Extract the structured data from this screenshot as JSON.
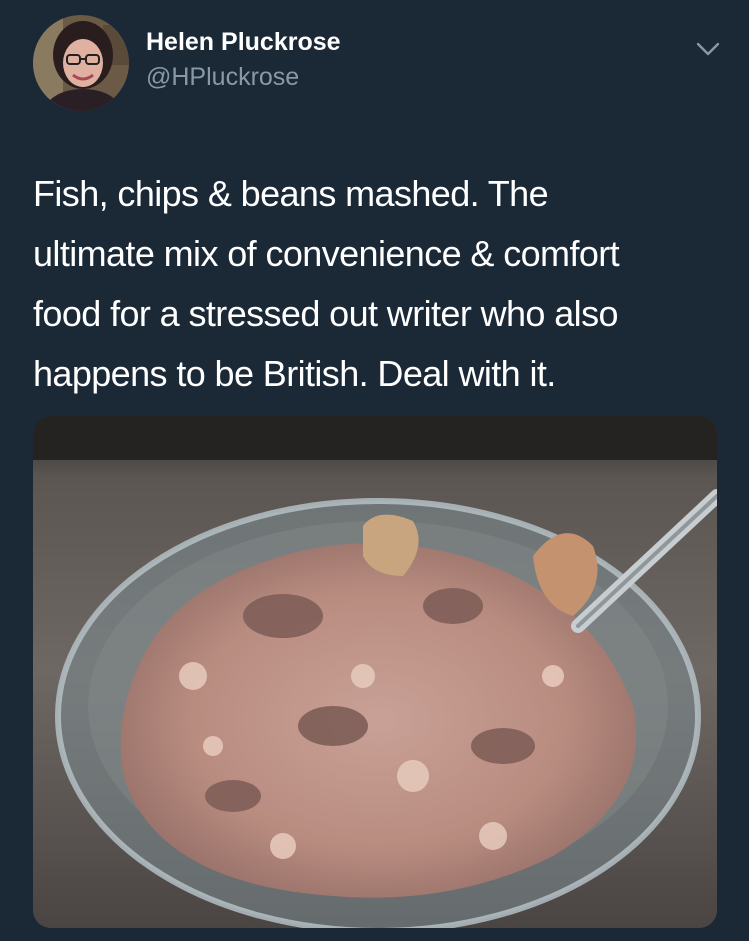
{
  "tweet": {
    "author": {
      "name": "Helen Pluckrose",
      "handle": "@HPluckrose",
      "avatar_icon": "profile-photo"
    },
    "menu_icon": "chevron-down-icon",
    "text_lines": [
      "Fish, chips & beans mashed. The",
      "ultimate mix of convenience & comfort",
      "food for a stressed out writer who also",
      "happens to be British. Deal with it."
    ],
    "media_icon": "food-photo"
  },
  "colors": {
    "background": "#1b2836",
    "primary_text": "#ffffff",
    "secondary_text": "#8899a6"
  }
}
